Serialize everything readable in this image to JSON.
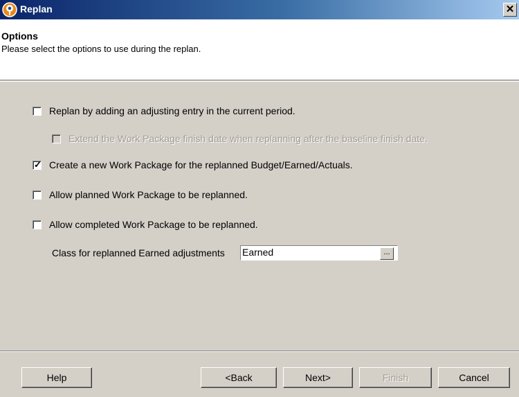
{
  "window": {
    "title": "Replan",
    "close_glyph": "✕"
  },
  "header": {
    "title": "Options",
    "subtitle": "Please select the options to use during the replan."
  },
  "options": [
    {
      "label": "Replan by adding an adjusting entry in the current period.",
      "checked": false,
      "enabled": true
    },
    {
      "label": "Extend the Work Package finish date when replanning after the baseline finish date.",
      "checked": false,
      "enabled": false
    },
    {
      "label": "Create a new Work Package for the replanned Budget/Earned/Actuals.",
      "checked": true,
      "enabled": true
    },
    {
      "label": "Allow planned Work Package to be replanned.",
      "checked": false,
      "enabled": true
    },
    {
      "label": "Allow completed Work Package to be replanned.",
      "checked": false,
      "enabled": true
    }
  ],
  "earned_class": {
    "label": "Class for replanned Earned adjustments",
    "value": "Earned",
    "browse_label": "..."
  },
  "buttons": {
    "help": "Help",
    "back": "<Back",
    "next": "Next>",
    "finish": "Finish",
    "cancel": "Cancel"
  },
  "icons": {
    "app": "replan-target-icon",
    "check": "✓"
  },
  "colors": {
    "titlebar_start": "#0a246a",
    "titlebar_end": "#a6caf0",
    "dialog_bg": "#d4d0c8"
  }
}
